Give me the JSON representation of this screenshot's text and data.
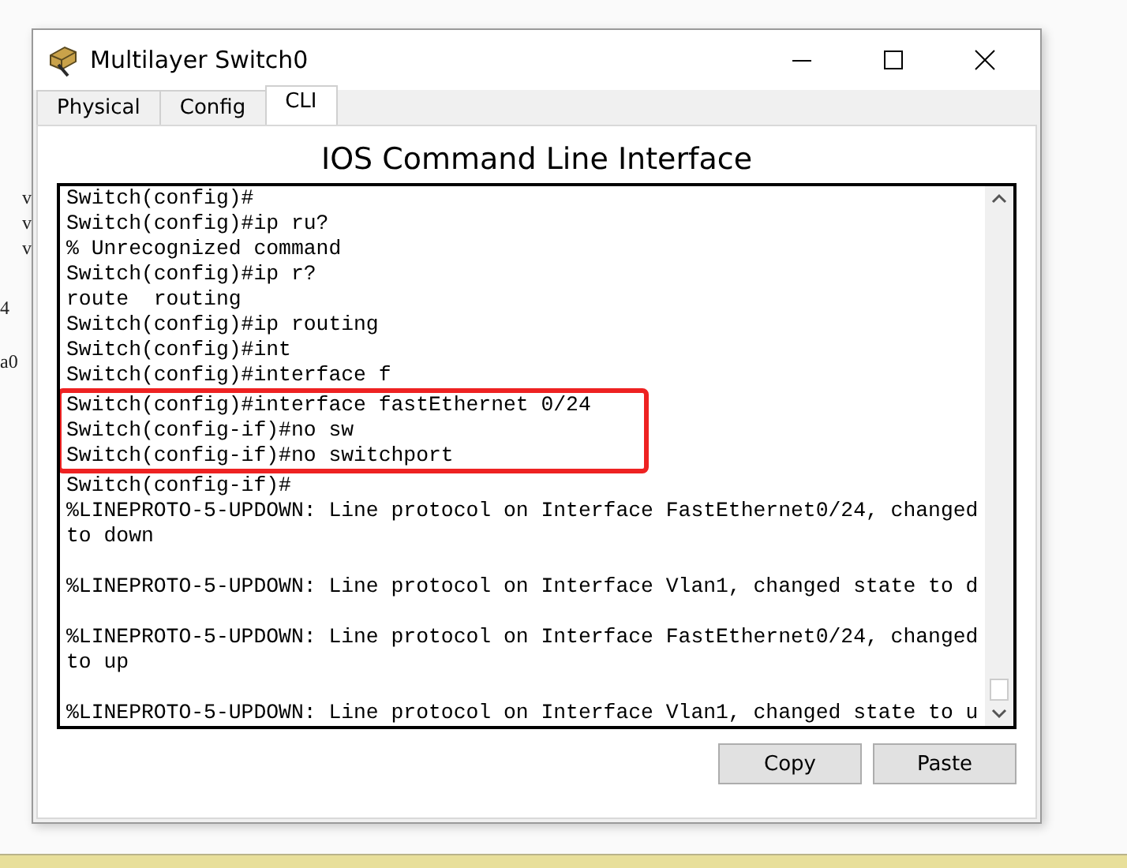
{
  "background": {
    "fragments": [
      "v",
      "v",
      "v",
      "4",
      "a0"
    ]
  },
  "window": {
    "title": "Multilayer Switch0"
  },
  "tabs": [
    {
      "label": "Physical",
      "selected": false
    },
    {
      "label": "Config",
      "selected": false
    },
    {
      "label": "CLI",
      "selected": true
    }
  ],
  "heading": "IOS Command Line Interface",
  "terminal": {
    "blocks": [
      {
        "lines": [
          {
            "text": "Switch(config)#",
            "highlighted": false
          },
          {
            "text": "Switch(config)#ip ru?",
            "highlighted": false
          },
          {
            "text": "% Unrecognized command",
            "highlighted": false
          },
          {
            "text": "Switch(config)#ip r?",
            "highlighted": false
          },
          {
            "text": "route  routing",
            "highlighted": false
          },
          {
            "text": "Switch(config)#ip routing",
            "highlighted": false
          },
          {
            "text": "Switch(config)#int",
            "highlighted": false
          },
          {
            "text": "Switch(config)#interface f",
            "highlighted": false
          },
          {
            "text": "Switch(config)#interface fastEthernet 0/24",
            "highlighted": true
          },
          {
            "text": "Switch(config-if)#no sw",
            "highlighted": true
          },
          {
            "text": "Switch(config-if)#no switchport",
            "highlighted": true
          },
          {
            "text": "Switch(config-if)#",
            "highlighted": false
          },
          {
            "text": "%LINEPROTO-5-UPDOWN: Line protocol on Interface FastEthernet0/24, changed",
            "highlighted": false
          },
          {
            "text": "to down",
            "highlighted": false
          }
        ]
      },
      {
        "lines": [
          {
            "text": "%LINEPROTO-5-UPDOWN: Line protocol on Interface Vlan1, changed state to d",
            "highlighted": false
          }
        ]
      },
      {
        "lines": [
          {
            "text": "%LINEPROTO-5-UPDOWN: Line protocol on Interface FastEthernet0/24, changed",
            "highlighted": false
          },
          {
            "text": "to up",
            "highlighted": false
          }
        ]
      },
      {
        "lines": [
          {
            "text": "%LINEPROTO-5-UPDOWN: Line protocol on Interface Vlan1, changed state to u",
            "highlighted": false
          }
        ]
      }
    ]
  },
  "buttons": [
    {
      "label": "Copy"
    },
    {
      "label": "Paste"
    }
  ]
}
